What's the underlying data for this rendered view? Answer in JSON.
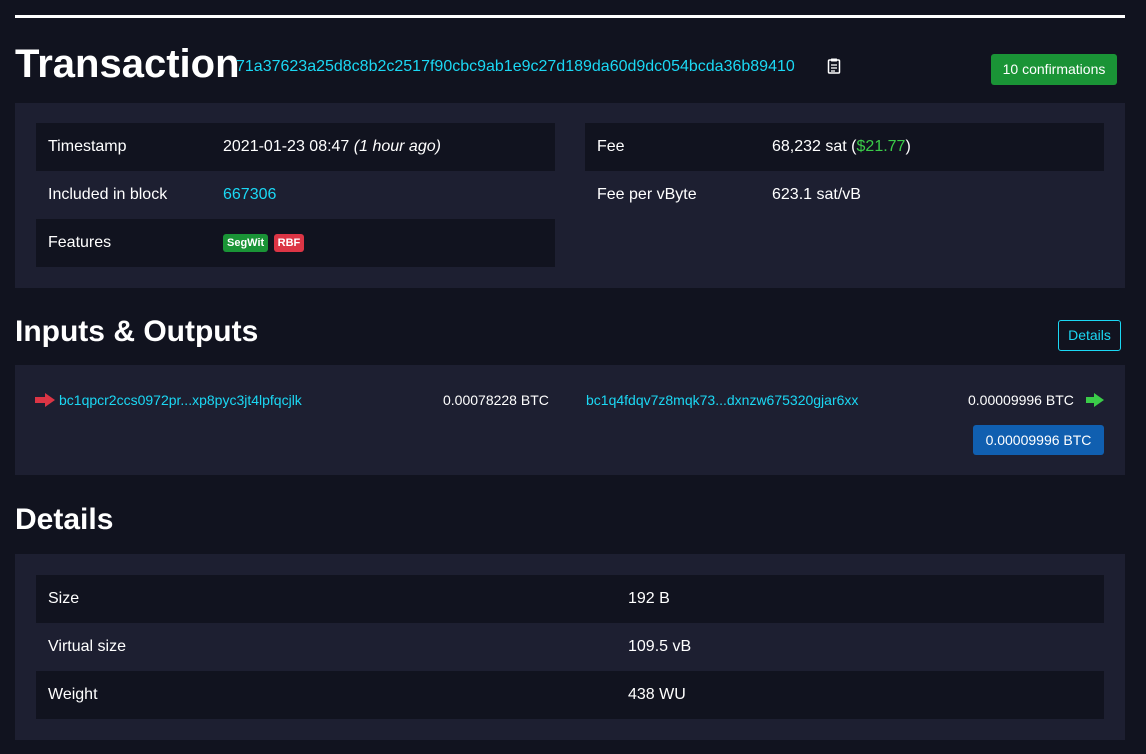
{
  "header": {
    "title": "Transaction",
    "txid": "71a37623a25d8c8b2c2517f90cbc9ab1e9c27d189da60d9dc054bcda36b89410",
    "confirmations": "10 confirmations"
  },
  "summary": {
    "left": [
      {
        "label": "Timestamp",
        "value": "2021-01-23 08:47",
        "value_suffix": "(1 hour ago)"
      },
      {
        "label": "Included in block",
        "value": "667306"
      },
      {
        "label": "Features",
        "badges": [
          "SegWit",
          "RBF"
        ]
      }
    ],
    "right": [
      {
        "label": "Fee",
        "value": "68,232 sat",
        "fiat": "$21.77"
      },
      {
        "label": "Fee per vByte",
        "value": "623.1 sat/vB"
      }
    ]
  },
  "io": {
    "title": "Inputs & Outputs",
    "details_button": "Details",
    "input": {
      "address": "bc1qpcr2ccs0972pr...xp8pyc3jt4lpfqcjlk",
      "amount": "0.00078228 BTC"
    },
    "output": {
      "address": "bc1q4fdqv7z8mqk73...dxnzw675320gjar6xx",
      "amount": "0.00009996 BTC"
    },
    "total": "0.00009996 BTC"
  },
  "details": {
    "title": "Details",
    "rows": [
      {
        "label": "Size",
        "value": "192 B"
      },
      {
        "label": "Virtual size",
        "value": "109.5 vB"
      },
      {
        "label": "Weight",
        "value": "438 WU"
      }
    ]
  },
  "icons": {
    "copy": "clipboard-icon",
    "input_arrow": "red-arrow-right-icon",
    "output_arrow": "green-arrow-right-icon"
  },
  "colors": {
    "background": "#11131f",
    "panel": "#1d1f31",
    "link": "#1bd8f4",
    "success": "#1a9436",
    "danger": "#dc3545",
    "primary": "#105fb0"
  }
}
